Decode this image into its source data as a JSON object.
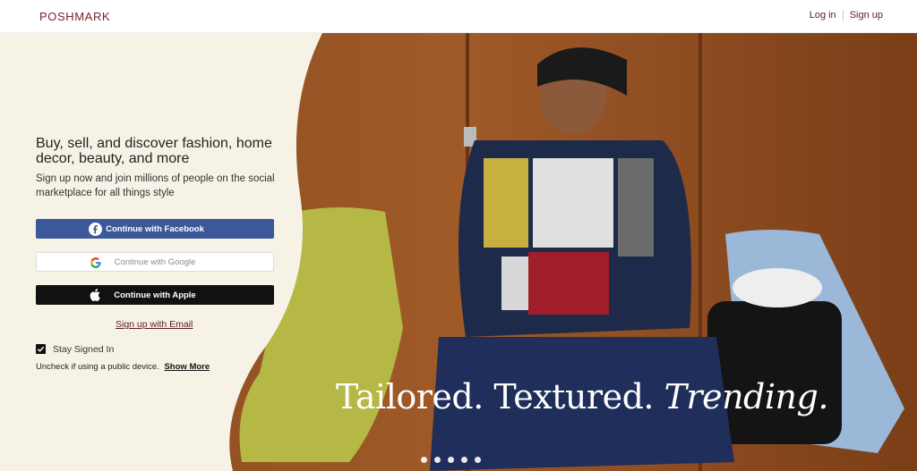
{
  "header": {
    "logo": "POSHMARK",
    "login_label": "Log in",
    "signup_label": "Sign up"
  },
  "hero": {
    "headline": "Buy, sell, and discover fashion, home decor, beauty, and more",
    "subtext": "Sign up now and join millions of people on the social marketplace for all things style",
    "facebook_label": "Continue with Facebook",
    "google_label": "Continue with Google",
    "apple_label": "Continue with Apple",
    "email_link": "Sign up with Email",
    "stay_signed_in": "Stay Signed In",
    "uncheck_note": "Uncheck if using a public device.",
    "show_more": "Show More",
    "tagline_part1": "Tailored. Textured. ",
    "tagline_part2": "Trending."
  },
  "carousel": {
    "dots": 5
  },
  "colors": {
    "brand": "#7a1f2b",
    "facebook": "#3b5998",
    "apple": "#111111",
    "panel_bg": "#f6f3e6"
  },
  "icons": [
    "facebook-icon",
    "google-icon",
    "apple-icon",
    "checkbox-checked-icon"
  ]
}
